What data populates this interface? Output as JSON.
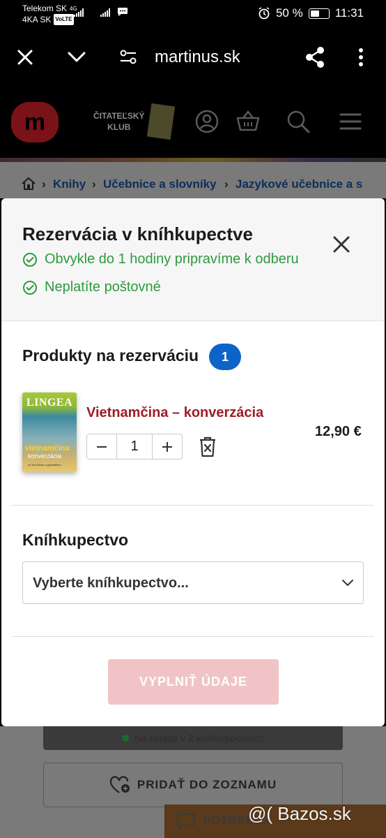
{
  "status_bar": {
    "carrier1": "Telekom SK",
    "carrier2": "4KA SK",
    "volte": "VoLTE",
    "net": "4G",
    "battery": "50 %",
    "time": "11:31"
  },
  "browser": {
    "url": "martinus.sk"
  },
  "site_header": {
    "club_line1": "ČITATEĽSKÝ",
    "club_line2": "KLUB"
  },
  "breadcrumb": {
    "items": [
      "Knihy",
      "Učebnice a slovníky",
      "Jazykové učebnice a s"
    ]
  },
  "modal": {
    "title": "Rezervácia v kníhkupectve",
    "benefits": [
      "Obvykle do 1 hodiny pripravíme k odberu",
      "Neplatíte poštovné"
    ],
    "products_title": "Produkty na rezerváciu",
    "products_count": "1",
    "product": {
      "cover_brand": "LINGEA",
      "cover_title": "vietnamčina",
      "cover_subtitle": "konverzácia",
      "cover_note": "so slovníkom a gramatikou",
      "name": "Vietnamčina – konverzácia",
      "quantity": "1",
      "price": "12,90 €"
    },
    "store_title": "Kníhkupectvo",
    "store_select_value": "Vyberte kníhkupectvo...",
    "submit_label": "VYPLNIŤ ÚDAJE"
  },
  "background": {
    "stock_text": "Na sklade v 2 kníhkupectvách",
    "add_to_list": "PRIDAŤ DO ZOZNAMU",
    "help_label": "POTREBUJ"
  },
  "watermark": "@( Bazos.sk",
  "colors": {
    "accent_red": "#9b1d24",
    "success_green": "#2e9a3e",
    "badge_blue": "#0d63c8",
    "submit_disabled": "#f0c4c6"
  }
}
